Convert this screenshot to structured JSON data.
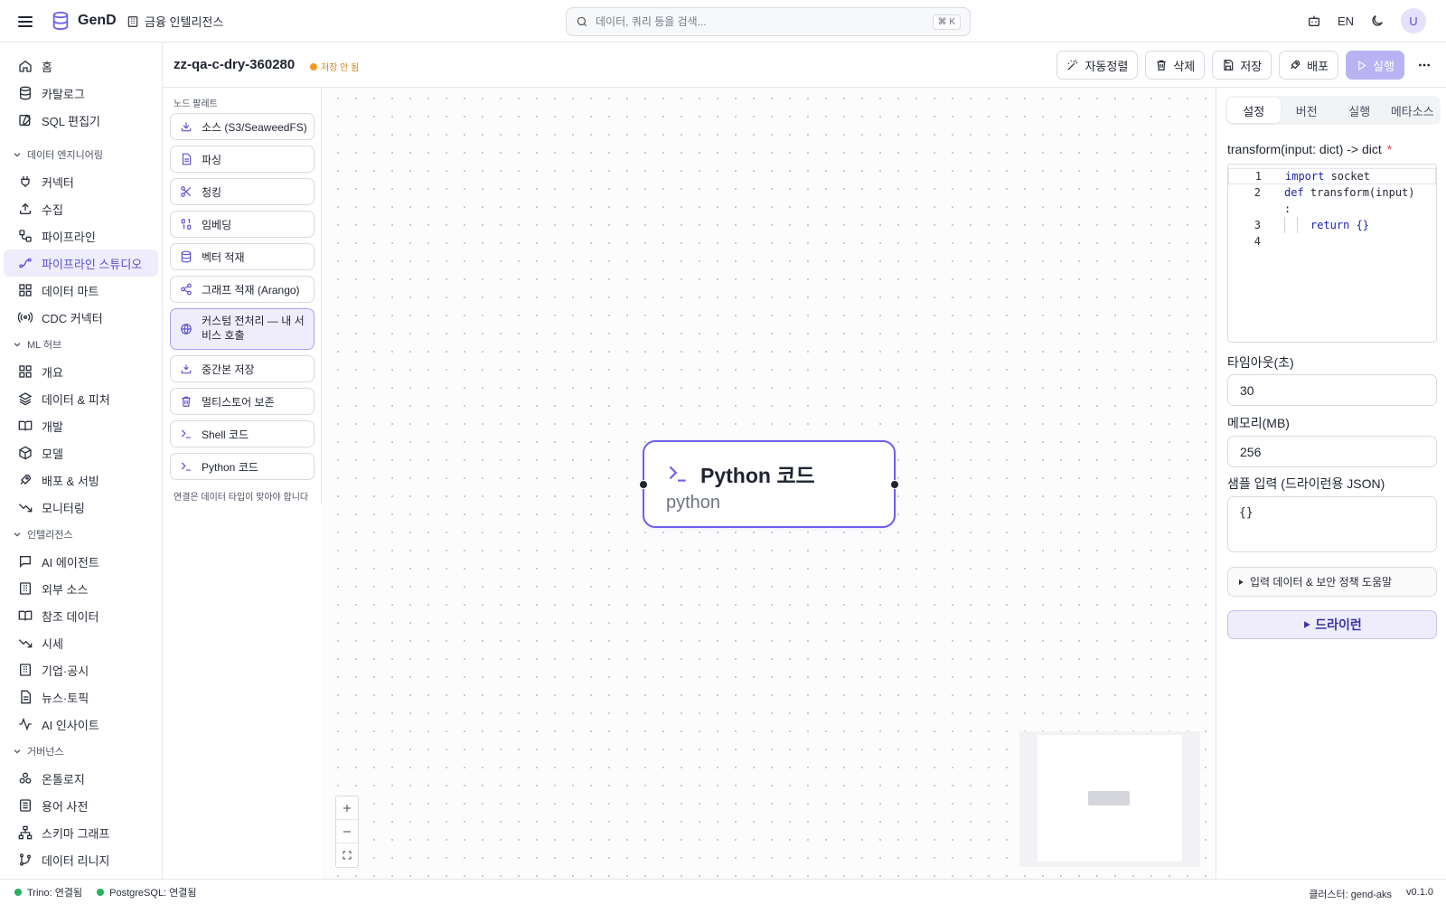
{
  "header": {
    "app_name": "GenD",
    "workspace": "금융 인텔리전스",
    "search_placeholder": "데이터, 쿼리 등을 검색...",
    "search_shortcut": "⌘ K",
    "lang": "EN",
    "avatar": "U"
  },
  "sidebar": {
    "top_items": [
      {
        "label": "홈",
        "icon": "home-icon"
      },
      {
        "label": "카탈로그",
        "icon": "database-icon"
      },
      {
        "label": "SQL 편집기",
        "icon": "edit-icon"
      }
    ],
    "sections": [
      {
        "title": "데이터 엔지니어링",
        "items": [
          {
            "label": "커넥터",
            "icon": "plug-icon"
          },
          {
            "label": "수집",
            "icon": "upload-icon"
          },
          {
            "label": "파이프라인",
            "icon": "workflow-icon"
          },
          {
            "label": "파이프라인 스튜디오",
            "icon": "spline-icon",
            "active": true
          },
          {
            "label": "데이터 마트",
            "icon": "grid-icon"
          },
          {
            "label": "CDC 커넥터",
            "icon": "radio-icon"
          }
        ]
      },
      {
        "title": "ML 허브",
        "items": [
          {
            "label": "개요",
            "icon": "grid-icon"
          },
          {
            "label": "데이터 & 피처",
            "icon": "layers-icon"
          },
          {
            "label": "개발",
            "icon": "book-icon"
          },
          {
            "label": "모델",
            "icon": "box-icon"
          },
          {
            "label": "배포 & 서빙",
            "icon": "rocket-icon"
          },
          {
            "label": "모니터링",
            "icon": "trend-icon"
          }
        ]
      },
      {
        "title": "인텔리전스",
        "items": [
          {
            "label": "AI 에이전트",
            "icon": "message-icon"
          },
          {
            "label": "외부 소스",
            "icon": "building-icon"
          },
          {
            "label": "참조 데이터",
            "icon": "book-icon"
          },
          {
            "label": "시세",
            "icon": "trend-icon"
          },
          {
            "label": "기업·공시",
            "icon": "building-icon"
          },
          {
            "label": "뉴스·토픽",
            "icon": "document-icon"
          },
          {
            "label": "AI 인사이트",
            "icon": "activity-icon"
          }
        ]
      },
      {
        "title": "거버넌스",
        "items": [
          {
            "label": "온톨로지",
            "icon": "molecule-icon"
          },
          {
            "label": "용어 사전",
            "icon": "list-icon"
          },
          {
            "label": "스키마 그래프",
            "icon": "network-icon"
          },
          {
            "label": "데이터 리니지",
            "icon": "branch-icon"
          }
        ]
      }
    ]
  },
  "toolbar": {
    "pipeline_name": "zz-qa-c-dry-360280",
    "unsaved": "저장 안 됨",
    "autolayout": "자동정렬",
    "delete": "삭제",
    "save": "저장",
    "deploy": "배포",
    "run": "실행"
  },
  "palette": {
    "title": "노드 팔레트",
    "items": [
      {
        "label": "소스 (S3/SeaweedFS)",
        "icon": "download-icon"
      },
      {
        "label": "파싱",
        "icon": "document-icon"
      },
      {
        "label": "청킹",
        "icon": "scissors-icon"
      },
      {
        "label": "임베딩",
        "icon": "binary-icon"
      },
      {
        "label": "벡터 적재",
        "icon": "database-icon"
      },
      {
        "label": "그래프 적재 (Arango)",
        "icon": "share-icon"
      },
      {
        "label": "커스텀 전처리 — 내 서비스 호출",
        "icon": "globe-icon",
        "selected": true
      },
      {
        "label": "중간본 저장",
        "icon": "save-tray-icon"
      },
      {
        "label": "멀티스토어 보존",
        "icon": "trash-icon"
      },
      {
        "label": "Shell 코드",
        "icon": "terminal-icon"
      },
      {
        "label": "Python 코드",
        "icon": "terminal-icon"
      }
    ],
    "hint": "연결은 데이터 타입이 맞아야 합니다"
  },
  "canvas": {
    "node": {
      "title": "Python 코드",
      "subtitle": "python"
    }
  },
  "panel": {
    "tabs": [
      "설정",
      "버전",
      "실행",
      "메타소스"
    ],
    "active_tab": "설정",
    "code_label": "transform(input: dict) -> dict",
    "required_mark": "*",
    "code_lines": [
      {
        "num": "1",
        "kw": "import",
        "rest": " socket"
      },
      {
        "num": "2",
        "kw": "def",
        "rest": " transform(input)"
      },
      {
        "num": "",
        "kw": "",
        "rest": ":"
      },
      {
        "num": "3",
        "kw": "return",
        "rest": " {}"
      },
      {
        "num": "4",
        "kw": "",
        "rest": ""
      }
    ],
    "timeout_label": "타임아웃(초)",
    "timeout_value": "30",
    "memory_label": "메모리(MB)",
    "memory_value": "256",
    "sample_label": "샘플 입력 (드라이런용 JSON)",
    "sample_value": "{}",
    "help_label": "입력 데이터 & 보안 정책 도움말",
    "dryrun_label": "드라이런"
  },
  "status": {
    "trino": "Trino: 연결됨",
    "postgres": "PostgreSQL: 연결됨",
    "cluster": "클러스터: gend-aks",
    "version": "v0.1.0"
  },
  "colors": {
    "accent": "#6e5ff0",
    "accent_light": "#efedfc",
    "unsaved": "#f29b1b",
    "connected": "#22b35e"
  }
}
